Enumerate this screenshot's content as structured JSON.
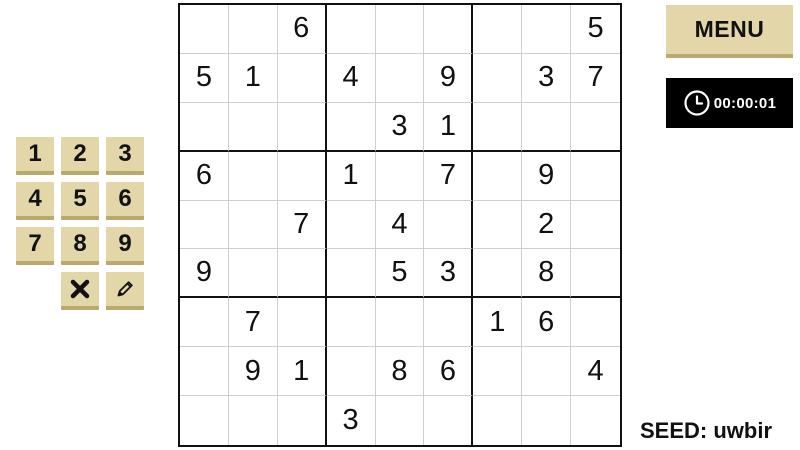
{
  "board": {
    "rows": [
      [
        "",
        "",
        "6",
        "",
        "",
        "",
        "",
        "",
        "5"
      ],
      [
        "5",
        "1",
        "",
        "4",
        "",
        "9",
        "",
        "3",
        "7"
      ],
      [
        "",
        "",
        "",
        "",
        "3",
        "1",
        "",
        "",
        ""
      ],
      [
        "6",
        "",
        "",
        "1",
        "",
        "7",
        "",
        "9",
        ""
      ],
      [
        "",
        "",
        "7",
        "",
        "4",
        "",
        "",
        "2",
        ""
      ],
      [
        "9",
        "",
        "",
        "",
        "5",
        "3",
        "",
        "8",
        ""
      ],
      [
        "",
        "7",
        "",
        "",
        "",
        "",
        "1",
        "6",
        ""
      ],
      [
        "",
        "9",
        "1",
        "",
        "8",
        "6",
        "",
        "",
        "4"
      ],
      [
        "",
        "",
        "",
        "3",
        "",
        "",
        "",
        "",
        ""
      ]
    ]
  },
  "numpad": {
    "digits": [
      "1",
      "2",
      "3",
      "4",
      "5",
      "6",
      "7",
      "8",
      "9"
    ],
    "erase_icon": "close-icon",
    "notes_icon": "pencil-icon"
  },
  "menu": {
    "label": "MENU"
  },
  "timer": {
    "icon": "clock-icon",
    "value": "00:00:01"
  },
  "seed": {
    "text": "SEED: uwbir"
  },
  "colors": {
    "button_face": "#e3d6a8",
    "button_shadow": "#b9a96e",
    "timer_background": "#000000",
    "grid_thick": "#111111",
    "grid_thin": "#cfcfcf"
  }
}
